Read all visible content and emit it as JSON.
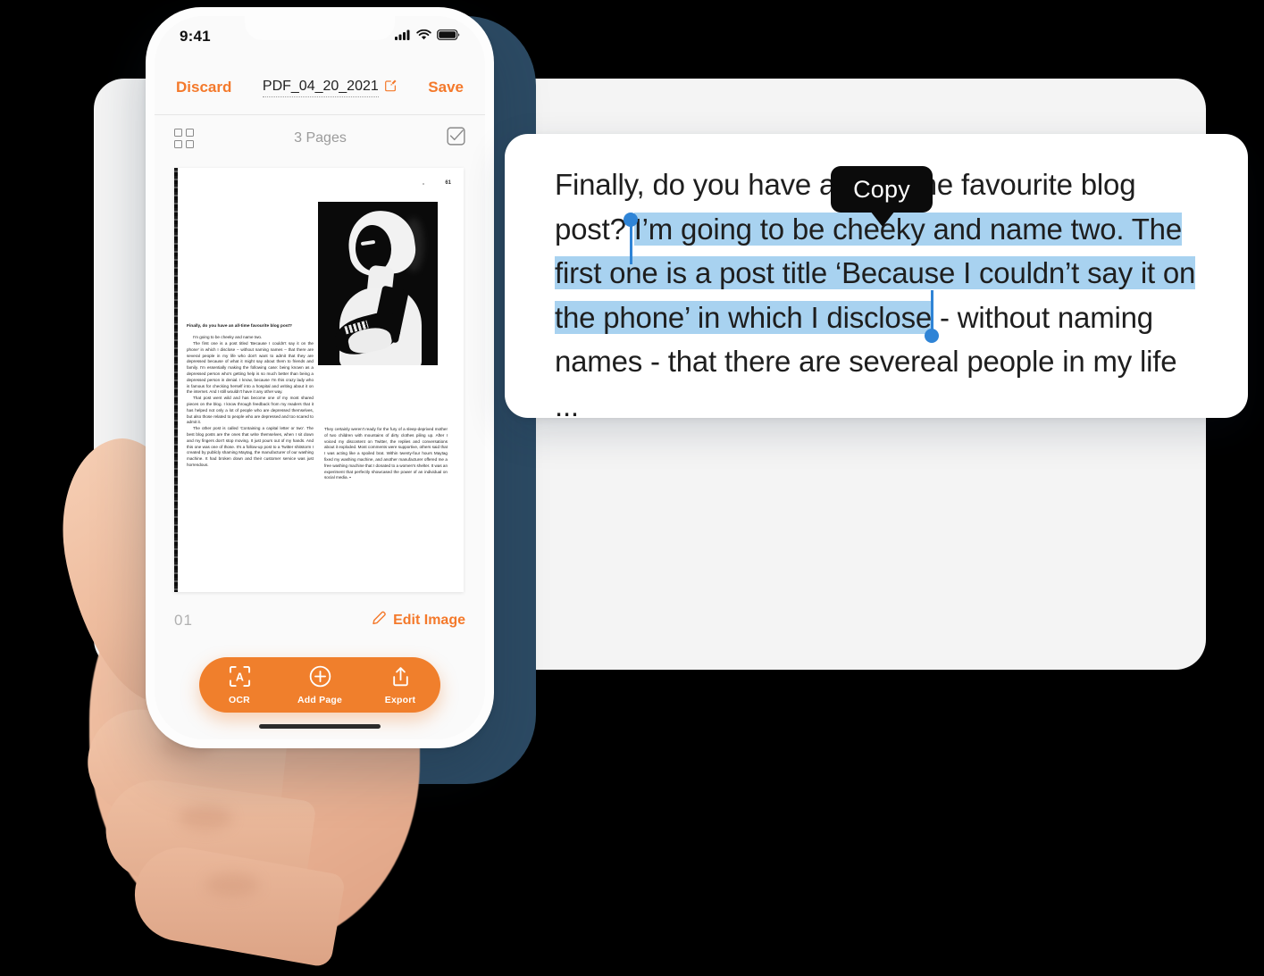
{
  "phone": {
    "status_bar": {
      "time": "9:41",
      "cellular_icon": "signal-bars-icon",
      "wifi_icon": "wifi-icon",
      "battery_icon": "battery-icon"
    },
    "nav_bar": {
      "discard_label": "Discard",
      "document_title": "PDF_04_20_2021",
      "edit_title_icon": "pencil-square-icon",
      "save_label": "Save"
    },
    "pages_bar": {
      "grid_icon": "grid-view-icon",
      "pages_count_label": "3 Pages",
      "select_icon": "checkbox-check-icon"
    },
    "page_footer": {
      "page_number": "01",
      "edit_image_label": "Edit Image",
      "edit_image_icon": "pencil-icon"
    },
    "action_bar": [
      {
        "id": "ocr",
        "label": "OCR",
        "icon": "scan-text-icon"
      },
      {
        "id": "add-page",
        "label": "Add Page",
        "icon": "plus-circle-icon"
      },
      {
        "id": "export",
        "label": "Export",
        "icon": "share-upload-icon"
      }
    ]
  },
  "scanned_page": {
    "page_folio": "61",
    "left_column": {
      "question": "Finally, do you have an all-time favourite blog post?",
      "paragraphs": [
        "I'm going to be cheeky and name two.",
        "The first one is a post titled 'Because I couldn't say it on the phone' in which I disclose – without naming names – that there are several people in my life who don't want to admit that they are depressed because of what it might say about them to friends and family. I'm essentially making the following case: being known as a depressed person who's getting help is so much better than being a depressed person in denial. I know, because I'm this crazy lady who is famous for checking herself into a hospital and writing about it on the internet. And I still wouldn't have it any other way.",
        "That post went wild and has become one of my most shared pieces on the blog. I know through feedback from my readers that it has helped not only a lot of people who are depressed themselves, but also those related to people who are depressed and too scared to admit it.",
        "The other post is called 'Containing a capital letter or two'. The best blog posts are the ones that write themselves, when I sit down and my fingers don't stop moving. It just pours out of my hands. And this one was one of those. It's a follow-up post to a Twitter shitstorm I created by publicly shaming Maytag, the manufacturer of our washing machine. It had broken down and their customer service was just horrendous."
      ]
    },
    "right_column": {
      "paragraphs": [
        "They certainly weren't ready for the fury of a sleep-deprived mother of two children with mountains of dirty clothes piling up. After I voiced my discontent on Twitter, the replies and conversations about it exploded. Most comments were supportive, others said that I was acting like a spoiled brat. Within twenty-four hours Maytag fixed my washing machine, and another manufacturer offered me a free washing machine that I donated to a women's shelter. It was an experiment that perfectly showcased the power of an individual on social media. ▪"
      ]
    }
  },
  "ocr_panel": {
    "tooltip_label": "Copy",
    "text_before": "Finally, do you have an all-time favourite blog post? ",
    "text_selected": "I’m going to be cheeky and name two. The first one is a post title ‘Because I couldn’t say it on the phone’ in which I disclose",
    "text_after": " - without naming names - that there are severeal people in my life ..."
  },
  "colors": {
    "accent_orange": "#F07F2C",
    "selection_blue": "#A8D2F0",
    "handle_blue": "#2F84D6",
    "blob_navy": "#2C4A63",
    "card_gray": "#F4F4F4"
  }
}
